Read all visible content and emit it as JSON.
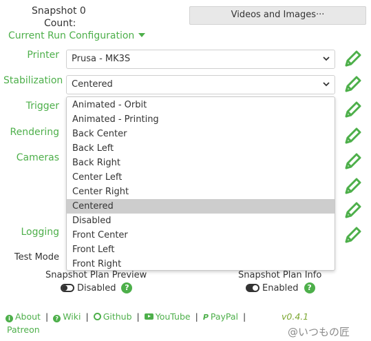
{
  "snapshot": {
    "title": "Snapshot 0",
    "count_label": "Count:"
  },
  "videos_button": "Videos and Images···",
  "run_config": {
    "label": "Current Run Configuration"
  },
  "rows": {
    "printer": {
      "label": "Printer",
      "value": "Prusa - MK3S"
    },
    "stabilization": {
      "label": "Stabilization",
      "value": "Centered"
    },
    "trigger": {
      "label": "Trigger"
    },
    "rendering": {
      "label": "Rendering"
    },
    "cameras": {
      "label": "Cameras"
    },
    "logging": {
      "label": "Logging"
    },
    "test_mode": {
      "label": "Test Mode"
    }
  },
  "dropdown": {
    "options": [
      "Animated - Orbit",
      "Animated - Printing",
      "Back Center",
      "Back Left",
      "Back Right",
      "Center Left",
      "Center Right",
      "Centered",
      "Disabled",
      "Front Center",
      "Front Left",
      "Front Right"
    ],
    "selected": "Centered"
  },
  "plan_preview": {
    "label": "Snapshot Plan Preview",
    "state": "Disabled"
  },
  "plan_info": {
    "label": "Snapshot Plan Info",
    "state": "Enabled"
  },
  "footer": {
    "about": "About",
    "wiki": "Wiki",
    "github": "Github",
    "youtube": "YouTube",
    "paypal": "PayPal",
    "patreon": "Patreon",
    "version": "v0.4.1"
  },
  "watermark": "@いつもの匠",
  "colors": {
    "accent": "#4daf4a",
    "selected_bg": "#cdcdcd",
    "version": "#7aa62f"
  },
  "icons": [
    "pencil-icon",
    "chevron-down-icon",
    "caret-down-icon",
    "question-circle-icon",
    "info-icon",
    "youtube-icon",
    "github-icon",
    "paypal-icon"
  ]
}
